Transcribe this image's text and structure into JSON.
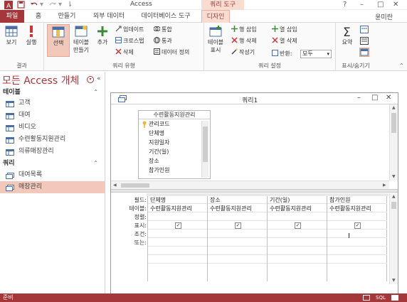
{
  "title_bar": {
    "app_title": "Access",
    "context_tab_label": "쿼리 도구",
    "help": "?",
    "minimize": "–",
    "restore": "□",
    "close": "✕"
  },
  "tabs": [
    {
      "label": "파일"
    },
    {
      "label": "홈"
    },
    {
      "label": "만들기"
    },
    {
      "label": "외부 데이터"
    },
    {
      "label": "데이터베이스 도구"
    },
    {
      "label": "디자인"
    }
  ],
  "user_name": "윤미란",
  "ribbon": {
    "results": {
      "label": "결과",
      "view": "보기",
      "run": "실행"
    },
    "query_type": {
      "label": "쿼리 유형",
      "select": "선택",
      "make_table_1": "테이블",
      "make_table_2": "만들기",
      "append": "추가",
      "update": "업데이트",
      "crosstab": "크로스탭",
      "delete": "삭제",
      "union": "통합",
      "pass_through": "통과",
      "data_definition": "데이터 정의"
    },
    "query_setup": {
      "label": "쿼리 설정",
      "show_table_1": "테이블",
      "show_table_2": "표시",
      "insert_rows": "행 삽입",
      "delete_rows": "행 삭제",
      "builder": "작성기",
      "insert_columns": "열 삽입",
      "delete_columns": "열 삭제",
      "return_label": "반환:",
      "return_value": "모두"
    },
    "show_hide": {
      "label": "표시/숨기기",
      "totals": "요약"
    }
  },
  "nav": {
    "title": "모든 Access 개체",
    "sections": [
      {
        "label": "테이블",
        "items": [
          "고객",
          "대여",
          "비디오",
          "수련활동지원관리",
          "의류매장관리"
        ]
      },
      {
        "label": "쿼리",
        "items": [
          "대여목록",
          "매장관리"
        ]
      }
    ]
  },
  "query_window": {
    "title": "쿼리1",
    "table": {
      "name": "수련활동지원관리",
      "fields": [
        "관리코드",
        "단체명",
        "지원일자",
        "기간(일)",
        "장소",
        "참가인원"
      ]
    },
    "row_labels": [
      "필드:",
      "테이블:",
      "정렬:",
      "표시:",
      "조건:",
      "또는:"
    ],
    "columns": [
      {
        "field": "단체명",
        "table": "수련활동지원관리",
        "show": true
      },
      {
        "field": "장소",
        "table": "수련활동지원관리",
        "show": true
      },
      {
        "field": "기간(일)",
        "table": "수련활동지원관리",
        "show": true
      },
      {
        "field": "참가인원",
        "table": "수련활동지원관리",
        "show": true
      }
    ],
    "checkmark": "✓"
  },
  "status": {
    "text": "준비",
    "zoom": "SQL"
  },
  "colors": {
    "accent": "#a4373a",
    "selected": "#f2c8bb"
  }
}
